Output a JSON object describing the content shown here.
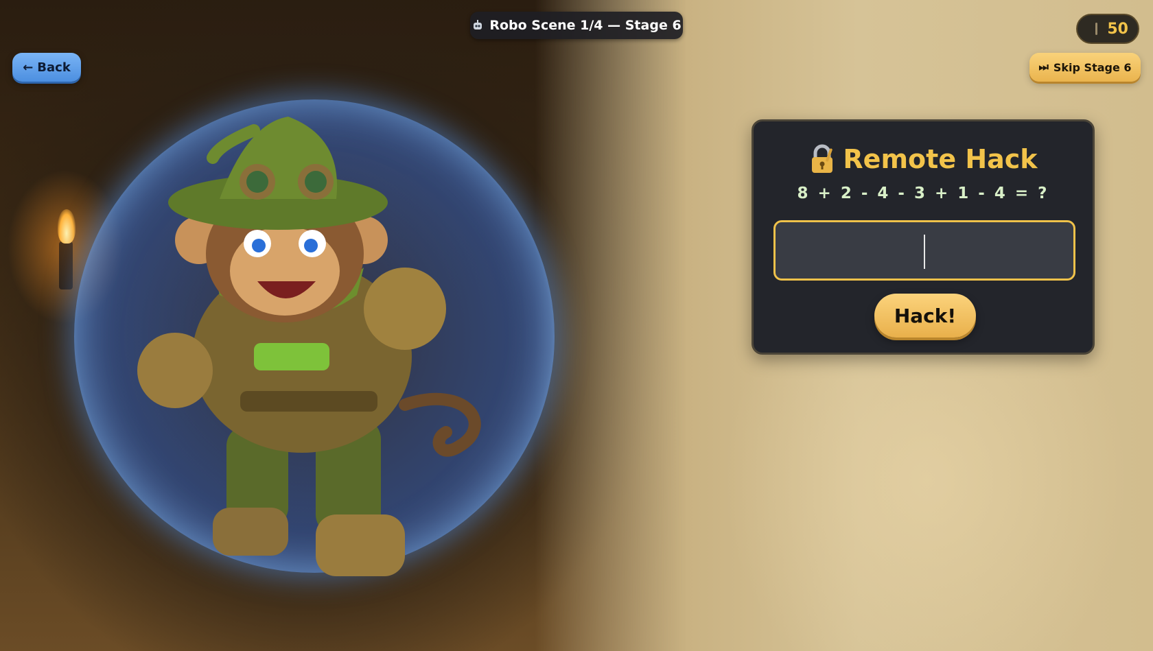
{
  "hud": {
    "scene_title": "Robo Scene 1/4 — Stage 6",
    "score": "50"
  },
  "nav": {
    "back_label": "Back",
    "skip_label": "Skip Stage 6"
  },
  "hack_panel": {
    "title": "Remote Hack",
    "equation": "8 + 2 - 4 - 3 + 1 - 4 = ?",
    "answer_value": "",
    "submit_label": "Hack!"
  },
  "icons": {
    "back": "left-arrow-icon",
    "skip": "fast-forward-icon",
    "title": "robot-icon",
    "panel": "lock-key-icon",
    "score": "coin-icon"
  },
  "colors": {
    "accent_gold": "#f2c34a",
    "panel_bg": "#23252b",
    "back_blue": "#5a9be8",
    "equation_text": "#d9f0c8"
  }
}
